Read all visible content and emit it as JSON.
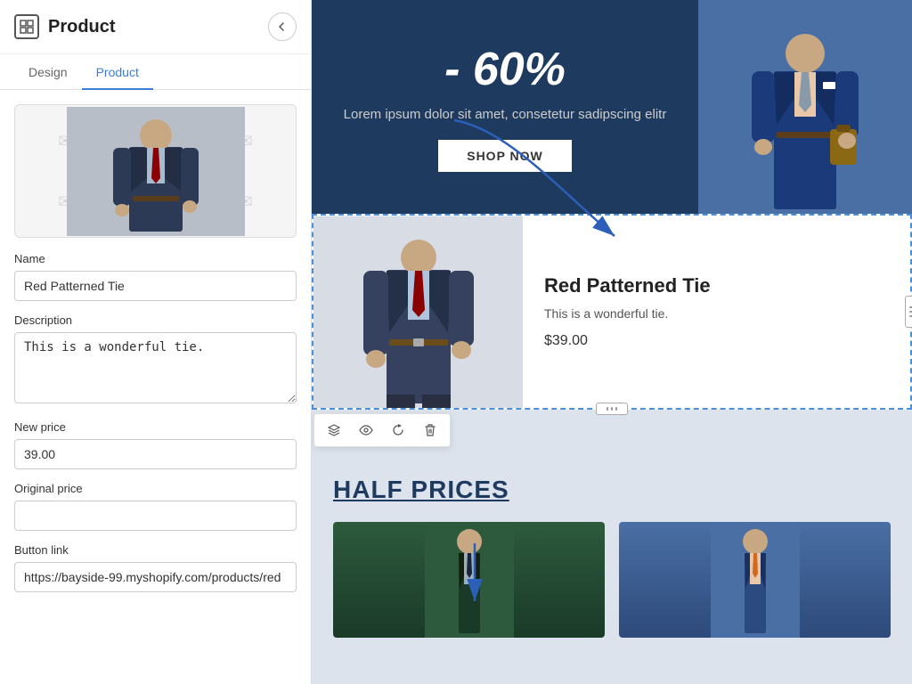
{
  "panel": {
    "title": "Product",
    "back_label": "←",
    "icon_symbol": "⊞"
  },
  "tabs": [
    {
      "id": "design",
      "label": "Design",
      "active": false
    },
    {
      "id": "product",
      "label": "Product",
      "active": true
    }
  ],
  "form": {
    "name_label": "Name",
    "name_value": "Red Patterned Tie",
    "name_placeholder": "",
    "description_label": "Description",
    "description_value": "This is a wonderful tie.",
    "new_price_label": "New price",
    "new_price_value": "39.00",
    "original_price_label": "Original price",
    "original_price_value": "",
    "button_link_label": "Button link",
    "button_link_value": "https://bayside-99.myshopify.com/products/red"
  },
  "hero": {
    "discount": "- 60%",
    "subtitle": "Lorem ipsum dolor sit amet, consetetur sadipscing elitr",
    "shop_btn": "SHOP NOW"
  },
  "product_card": {
    "name": "Red Patterned Tie",
    "description": "This is a wonderful tie.",
    "price": "$39.00"
  },
  "half_prices": {
    "title": "HALF PRICES"
  },
  "toolbar": {
    "layers_icon": "≡",
    "eye_icon": "👁",
    "refresh_icon": "↺",
    "delete_icon": "🗑"
  }
}
